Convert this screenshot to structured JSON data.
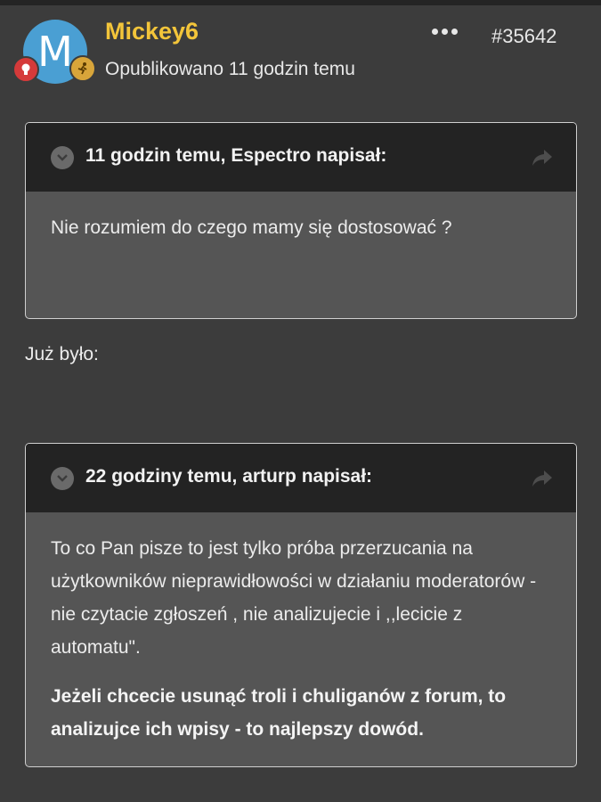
{
  "post": {
    "author": "Mickey6",
    "avatar_letter": "M",
    "published": "Opublikowano 11 godzin temu",
    "post_id": "#35642",
    "more_icon": "ellipsis-icon",
    "accent_color": "#f3c53a"
  },
  "quotes": [
    {
      "title": "11 godzin temu, Espectro napisał:",
      "paragraphs": [
        "Nie rozumiem do czego mamy się dostosować ?"
      ]
    },
    {
      "title": "22 godziny temu, arturp napisał:",
      "paragraphs": [
        "To co Pan pisze to jest tylko próba przerzucania na użytkowników nieprawidłowości w działaniu moderatorów - nie czytacie zgłoszeń , nie analizujecie i ,,lecicie z automatu\".",
        "Jeżeli chcecie usunąć troli i chuliganów z forum, to analizujce ich wpisy - to najlepszy dowód."
      ]
    }
  ],
  "body_text": "Już było:"
}
